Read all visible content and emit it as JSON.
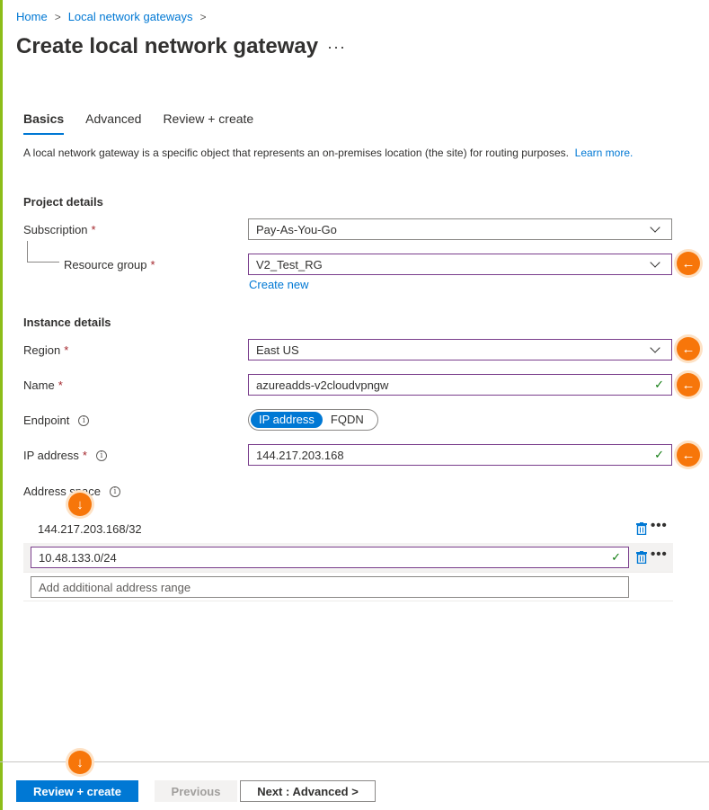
{
  "breadcrumb": {
    "home": "Home",
    "gateways": "Local network gateways"
  },
  "page": {
    "title": "Create local network gateway",
    "more": "···"
  },
  "tabs": [
    {
      "label": "Basics",
      "active": true
    },
    {
      "label": "Advanced",
      "active": false
    },
    {
      "label": "Review + create",
      "active": false
    }
  ],
  "description": {
    "text": "A local network gateway is a specific object that represents an on-premises location (the site) for routing purposes.",
    "learn_more": "Learn more."
  },
  "project": {
    "heading": "Project details",
    "subscription_label": "Subscription",
    "subscription_value": "Pay-As-You-Go",
    "resource_group_label": "Resource group",
    "resource_group_value": "V2_Test_RG",
    "create_new": "Create new"
  },
  "instance": {
    "heading": "Instance details",
    "region_label": "Region",
    "region_value": "East US",
    "name_label": "Name",
    "name_value": "azureadds-v2cloudvpngw",
    "endpoint_label": "Endpoint",
    "endpoint_options": [
      "IP address",
      "FQDN"
    ],
    "ip_label": "IP address",
    "ip_value": "144.217.203.168",
    "address_space_label": "Address space",
    "address_ranges": [
      "144.217.203.168/32",
      "10.48.133.0/24"
    ],
    "add_range_placeholder": "Add additional address range"
  },
  "footer": {
    "review_create": "Review + create",
    "previous": "Previous",
    "next": "Next : Advanced >"
  },
  "colors": {
    "accent_bar": "#8cbd18",
    "primary": "#0078d4",
    "highlight_border": "#7a3e8c",
    "marker": "#f7760a",
    "required": "#a4262c",
    "valid": "#107c10"
  },
  "icons": {
    "marker_left": "←",
    "marker_down": "↓",
    "check": "✓",
    "required": "*",
    "info": "i"
  }
}
